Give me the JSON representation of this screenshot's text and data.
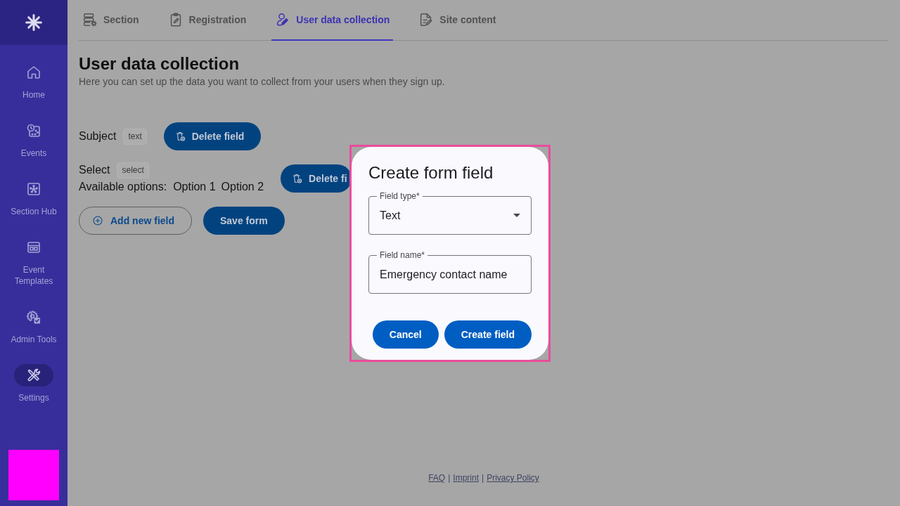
{
  "sidebar": {
    "items": [
      {
        "label": "Home",
        "selected": false
      },
      {
        "label": "Events",
        "selected": false
      },
      {
        "label": "Section Hub",
        "selected": false
      },
      {
        "label": "Event Templates",
        "selected": false
      },
      {
        "label": "Admin Tools",
        "selected": false
      },
      {
        "label": "Settings",
        "selected": true
      }
    ]
  },
  "tabs": [
    {
      "label": "Section",
      "selected": false
    },
    {
      "label": "Registration",
      "selected": false
    },
    {
      "label": "User data collection",
      "selected": true
    },
    {
      "label": "Site content",
      "selected": false
    }
  ],
  "header": {
    "title": "User data collection",
    "subtitle": "Here you can set up the data you want to collect from your users when they sign up."
  },
  "form_fields": [
    {
      "name": "Subject",
      "type": "text",
      "delete_button": "Delete field"
    },
    {
      "name": "Select",
      "type": "select",
      "options_label": "Available options:",
      "options": [
        "Option 1",
        "Option 2"
      ],
      "delete_button": "Delete fi"
    }
  ],
  "form_actions": {
    "add_button": "Add new field",
    "save_button": "Save form"
  },
  "footer": [
    {
      "kind": "link",
      "text": "FAQ"
    },
    {
      "kind": "separator",
      "text": "|"
    },
    {
      "kind": "link",
      "text": "Imprint"
    },
    {
      "kind": "separator",
      "text": "|"
    },
    {
      "kind": "link",
      "text": "Privacy Policy"
    }
  ],
  "dialog": {
    "title": "Create form field",
    "fields": [
      {
        "kind": "select",
        "label": "Field type*",
        "value": "Text"
      },
      {
        "kind": "text",
        "label": "Field name*",
        "value": "Emergency contact name"
      }
    ],
    "buttons": [
      {
        "label": "Cancel"
      },
      {
        "label": "Create field"
      }
    ]
  }
}
